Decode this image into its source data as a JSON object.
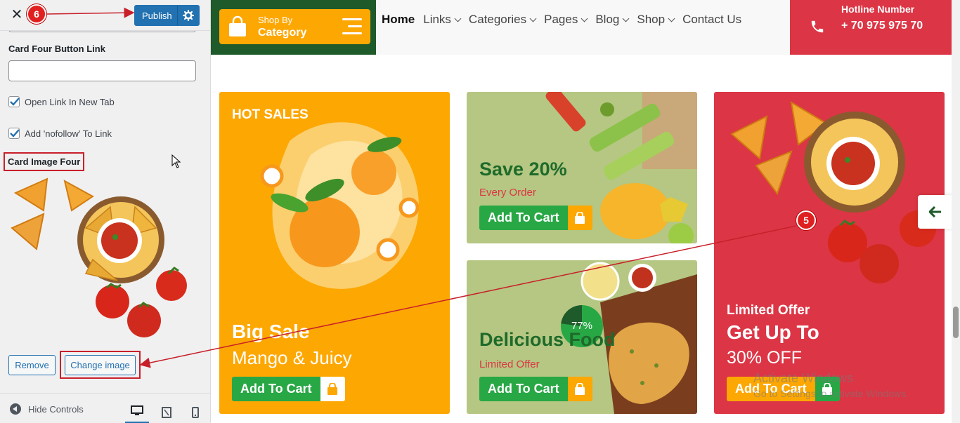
{
  "customizer": {
    "close_icon": "close-icon",
    "publish_label": "Publish",
    "settings_icon": "gear-icon",
    "button_link_label": "Card Four Button Link",
    "button_link_value": "",
    "checkbox_new_tab": "Open Link In New Tab",
    "checkbox_nofollow": "Add 'nofollow' To Link",
    "card_image_label": "Card Image Four",
    "remove_label": "Remove",
    "change_image_label": "Change image",
    "hide_controls_label": "Hide Controls",
    "devices": [
      "desktop-icon",
      "tablet-icon",
      "mobile-icon"
    ]
  },
  "annotations": {
    "badge_publish": "6",
    "badge_card": "5"
  },
  "site": {
    "shop_by_line1": "Shop By",
    "shop_by_line2": "Category",
    "nav": [
      {
        "label": "Home"
      },
      {
        "label": "Links"
      },
      {
        "label": "Categories"
      },
      {
        "label": "Pages"
      },
      {
        "label": "Blog"
      },
      {
        "label": "Shop"
      },
      {
        "label": "Contact Us"
      }
    ],
    "hotline_title": "Hotline Number",
    "hotline_number": "+ 70 975 975 70"
  },
  "cards": {
    "c1": {
      "tag": "HOT SALES",
      "title": "Big Sale",
      "subtitle": "Mango & Juicy",
      "button": "Add To Cart"
    },
    "c2": {
      "title": "Save 20%",
      "subtitle": "Every Order",
      "button": "Add To Cart"
    },
    "c3": {
      "title": "Delicious Food",
      "subtitle": "Limited Offer",
      "percent": "77%",
      "button": "Add To Cart"
    },
    "c4": {
      "eyebrow": "Limited Offer",
      "title": "Get Up To",
      "subtitle": "30% OFF",
      "button": "Add To Cart"
    }
  },
  "watermark": {
    "line1": "Activate Windows",
    "line2": "Go to Settings to activate Windows."
  },
  "colors": {
    "primary": "#2271b1",
    "orange": "#fda702",
    "green": "#28a745",
    "red": "#dc3545",
    "dark_green": "#1e5a2a"
  }
}
